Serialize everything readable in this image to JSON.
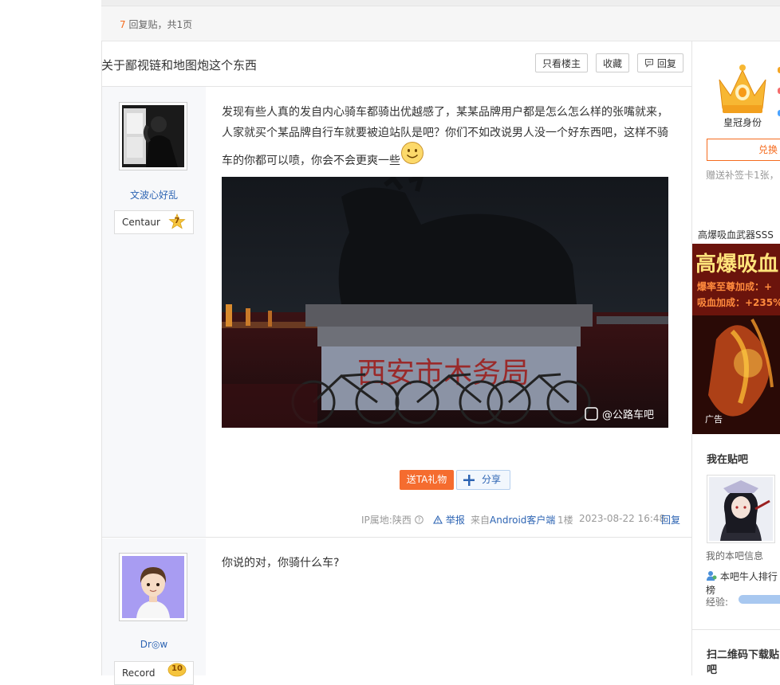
{
  "pager": {
    "reply_count": "7",
    "reply_suffix": "回复贴，共1页"
  },
  "thread": {
    "title": "关于鄙视链和地图炮这个东西",
    "btn_only_author": "只看楼主",
    "btn_collect": "收藏",
    "btn_reply": "回复"
  },
  "posts": [
    {
      "username": "文波心好乱",
      "badge_name": "Centaur",
      "badge_level": "7",
      "content_lines": [
        "发现有些人真的发自内心骑车都骑出优越感了，某某品牌用户都是怎么怎么样的张嘴就来，",
        "人家就买个某品牌自行车就要被迫站队是吧？你们不如改说男人没一个好东西吧，这样不骑",
        "车的你都可以喷，你会不会更爽一些"
      ],
      "image_sign": "西安市木务局",
      "image_watermark": "@公路车吧",
      "gift_label": "送TA礼物",
      "share_label": "分享",
      "ip_location": "IP属地:陕西",
      "report_label": "举报",
      "source_prefix": "来自",
      "source_client": "Android客户端",
      "floor": "1楼",
      "timestamp": "2023-08-22 16:48",
      "reply_label": "回复"
    },
    {
      "username": "Dr◎w",
      "badge_name": "Record",
      "badge_level": "10",
      "content_lines": [
        "你说的对，你骑什么车?"
      ]
    }
  ],
  "sidebar": {
    "crown_label": "皇冠身份",
    "exchange_label": "兑换",
    "gift_card_text": "赠送补签卡1张，",
    "ad_title": "高爆吸血武器SSS",
    "ad_banner_big": "高爆吸血",
    "ad_line1": "爆率至尊加成：+",
    "ad_line2": "吸血加成：+235%",
    "ad_tag": "广告",
    "my_bar_title": "我在贴吧",
    "my_info": "我的本吧信息",
    "rank_label": "本吧牛人排行榜",
    "exp_label": "经验:",
    "qr_title": "扫二维码下载贴吧"
  },
  "colors": {
    "accent_orange": "#f56c1f",
    "link_blue": "#2d64b3",
    "exp_bar": "#a8c8f0"
  }
}
